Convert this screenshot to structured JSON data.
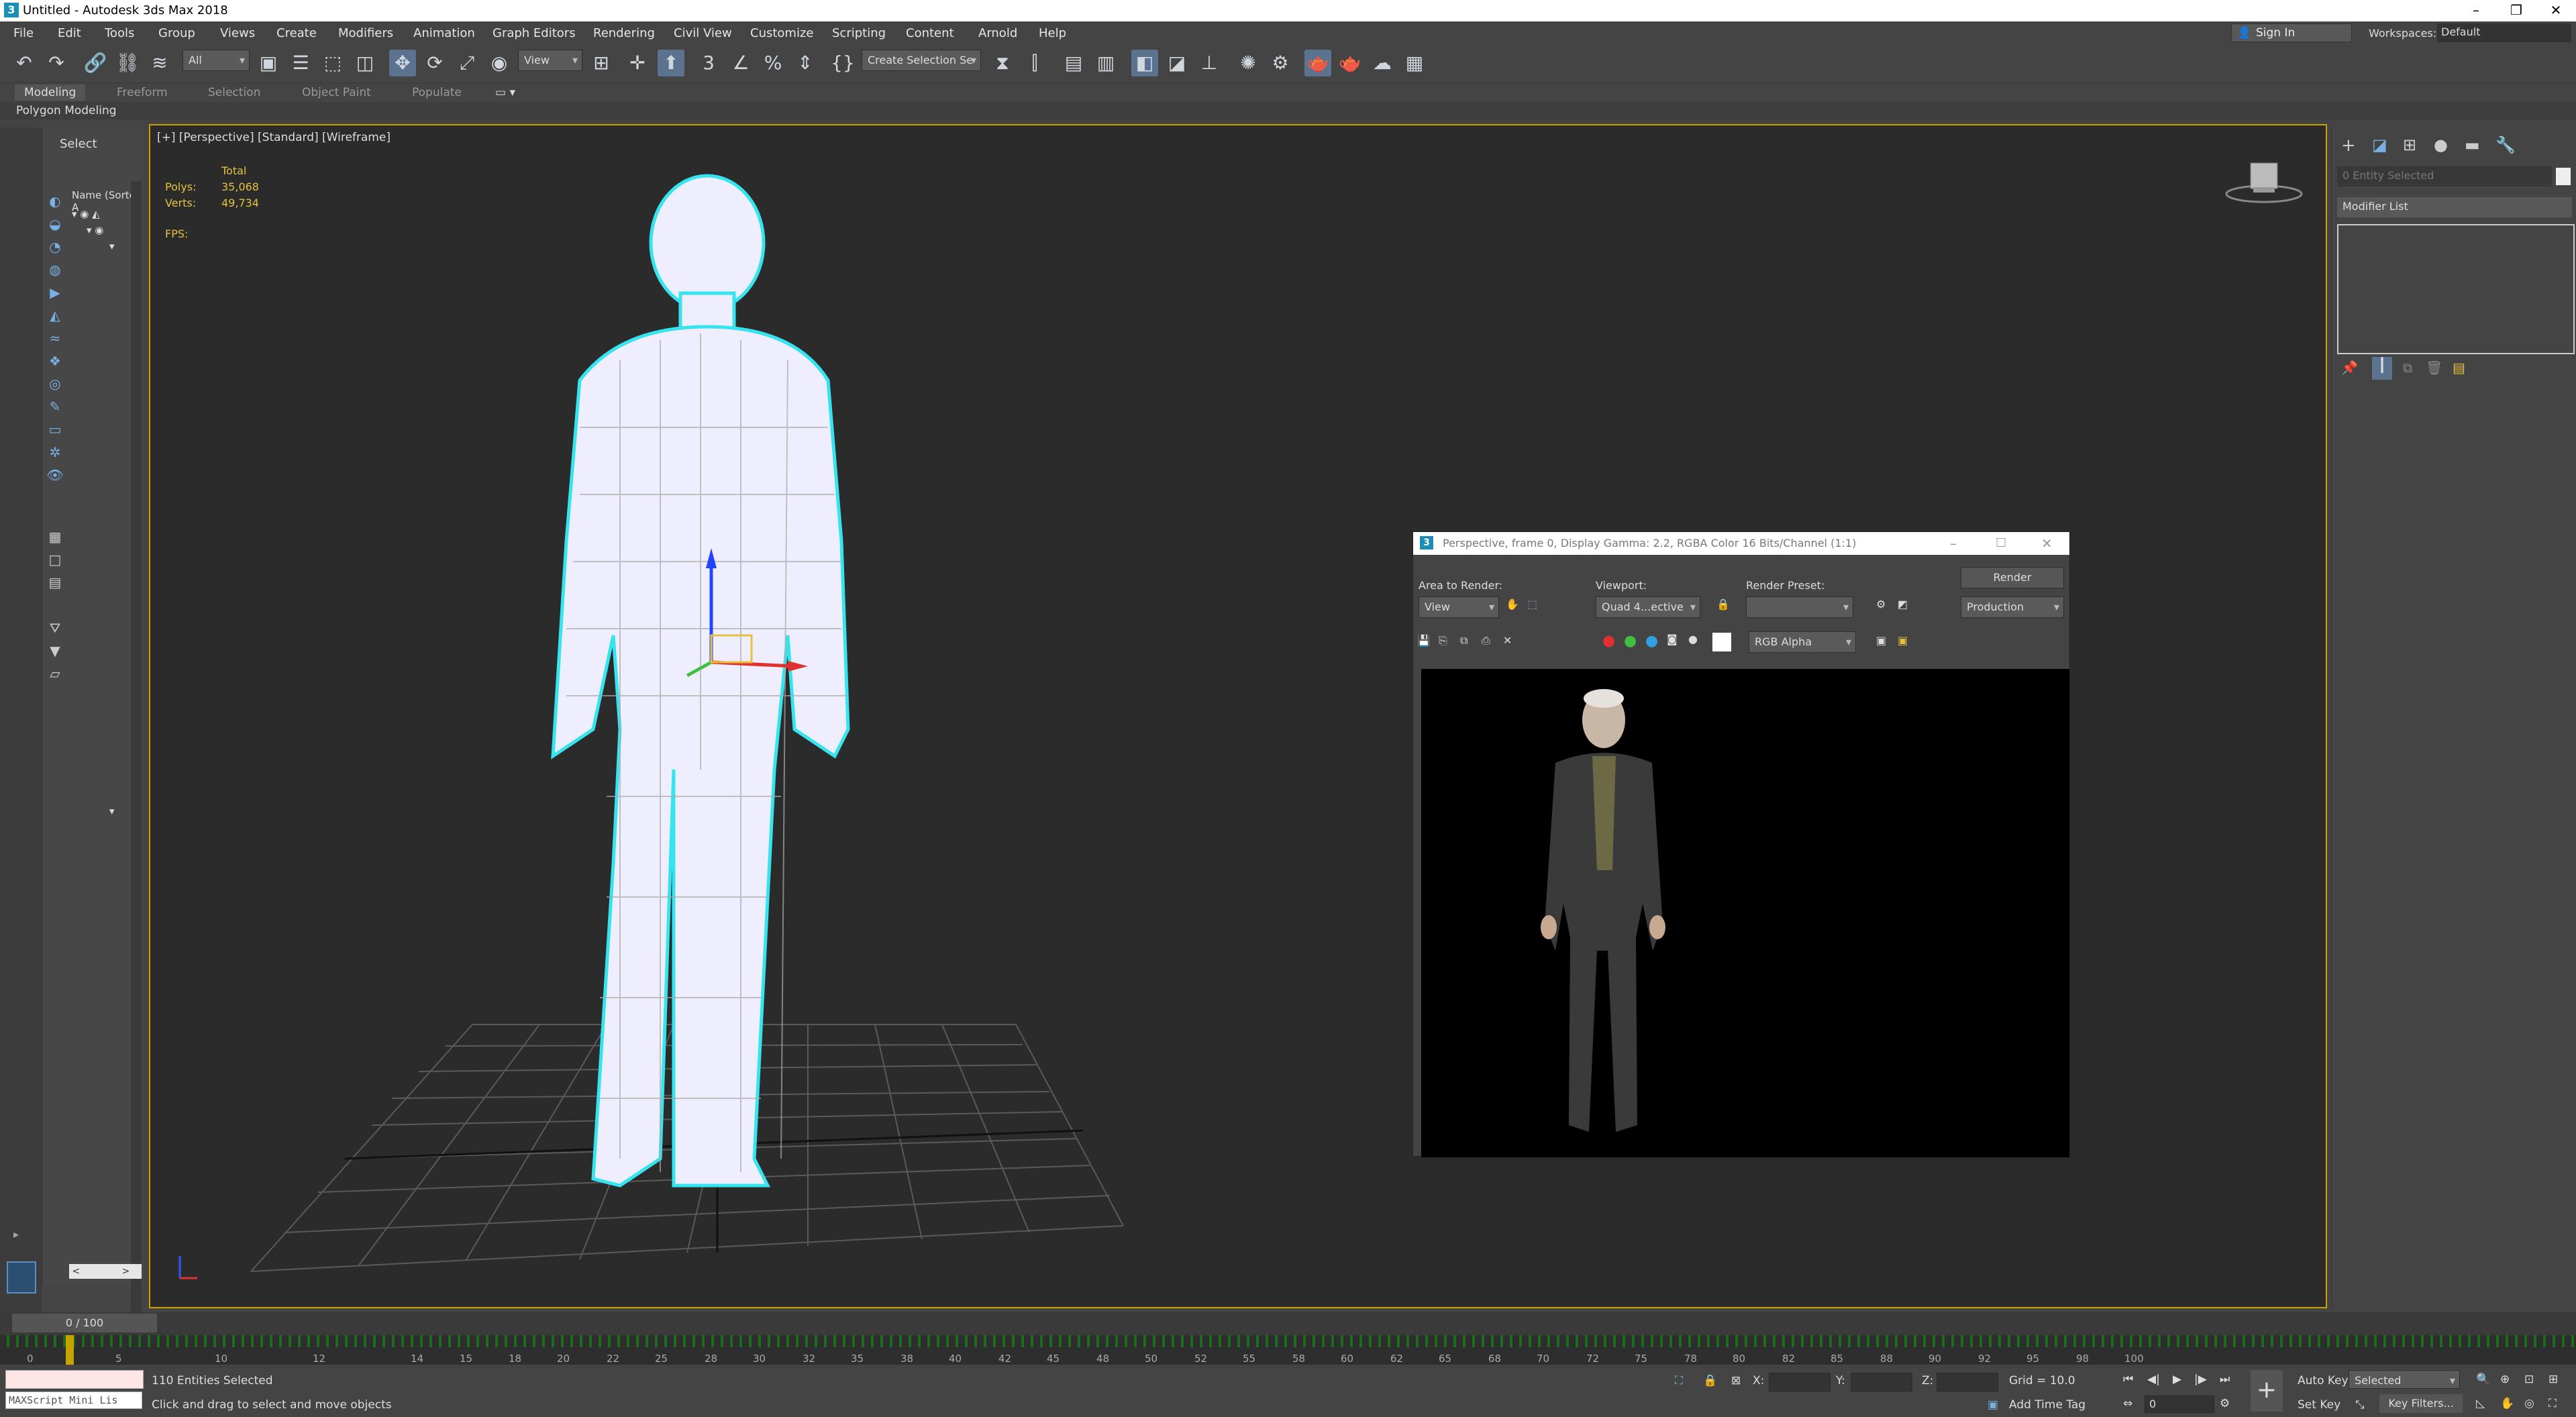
{
  "window": {
    "title": "Untitled - Autodesk 3ds Max 2018"
  },
  "menu": [
    "File",
    "Edit",
    "Tools",
    "Group",
    "Views",
    "Create",
    "Modifiers",
    "Animation",
    "Graph Editors",
    "Rendering",
    "Civil View",
    "Customize",
    "Scripting",
    "Content",
    "Arnold",
    "Help"
  ],
  "account": {
    "sign_in": "Sign In",
    "workspaces_label": "Workspaces:",
    "workspace_value": "Default"
  },
  "toolbar": {
    "filter": "All",
    "ref_coord": "View",
    "selection_set": "Create Selection Se"
  },
  "ribbon": {
    "tabs": [
      "Modeling",
      "Freeform",
      "Selection",
      "Object Paint",
      "Populate"
    ],
    "sub": "Polygon Modeling"
  },
  "scene_explorer": {
    "header": "Select",
    "column": "Name (Sorted A"
  },
  "viewport": {
    "label": "[+] [Perspective] [Standard] [Wireframe]",
    "stats_total": "Total",
    "polys_label": "Polys:",
    "polys_value": "35,068",
    "verts_label": "Verts:",
    "verts_value": "49,734",
    "fps_label": "FPS:"
  },
  "render_window": {
    "title": "Perspective, frame 0, Display Gamma: 2.2, RGBA Color 16 Bits/Channel (1:1)",
    "area_label": "Area to Render:",
    "area_value": "View",
    "viewport_label": "Viewport:",
    "viewport_value": "Quad 4...ective",
    "preset_label": "Render Preset:",
    "preset_value": "",
    "render_button": "Render",
    "mode_value": "Production",
    "channel_value": "RGB Alpha"
  },
  "command_panel": {
    "entity": "0 Entity Selected",
    "modifier_list": "Modifier List"
  },
  "timeline": {
    "frame": "0 / 100",
    "ticks": [
      "0",
      "5",
      "10",
      "12",
      "14",
      "15",
      "18",
      "20",
      "22",
      "25",
      "28",
      "30",
      "32",
      "35",
      "38",
      "40",
      "42",
      "45",
      "48",
      "50",
      "52",
      "55",
      "58",
      "60",
      "62",
      "65",
      "68",
      "70",
      "72",
      "75",
      "78",
      "80",
      "82",
      "85",
      "88",
      "90",
      "92",
      "95",
      "98",
      "100"
    ]
  },
  "status": {
    "maxscript": "MAXScript Mini Lis",
    "selected": "110 Entities Selected",
    "prompt": "Click and drag to select and move objects",
    "x_label": "X:",
    "y_label": "Y:",
    "z_label": "Z:",
    "grid": "Grid = 10.0",
    "add_time_tag": "Add Time Tag",
    "auto_key": "Auto Key",
    "selected_label": "Selected",
    "set_key": "Set Key",
    "key_filters": "Key Filters...",
    "frame_value": "0"
  }
}
